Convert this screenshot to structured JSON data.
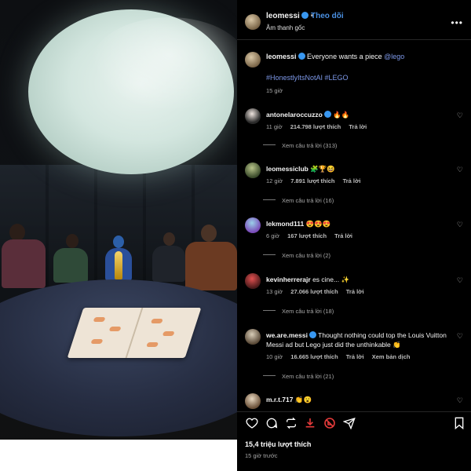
{
  "header": {
    "username": "leomessi",
    "separator": "•",
    "follow_label": "Theo dõi",
    "audio_label": "Âm thanh gốc",
    "more_icon": "more-horizontal-icon"
  },
  "caption": {
    "username": "leomessi",
    "text": "Everyone wants a piece",
    "mention": "@lego",
    "hashtags": "#HonestlyItsNotAI #LEGO",
    "time": "15 giờ"
  },
  "comments": [
    {
      "username": "antonelaroccuzzo",
      "body": "🔥🔥",
      "time": "11 giờ",
      "likes": "214.798 lượt thích",
      "reply": "Trả lời",
      "extra": "",
      "view_replies": "Xem câu trả lời (313)"
    },
    {
      "username": "leomessiclub",
      "body": "🧩🏆😆",
      "time": "12 giờ",
      "likes": "7.891 lượt thích",
      "reply": "Trả lời",
      "extra": "",
      "view_replies": "Xem câu trả lời (16)"
    },
    {
      "username": "lekmond111",
      "body": "😍😍😍",
      "time": "6 giờ",
      "likes": "167 lượt thích",
      "reply": "Trả lời",
      "extra": "",
      "view_replies": "Xem câu trả lời (2)"
    },
    {
      "username": "kevinherrerajr",
      "body": "es cine... ✨",
      "time": "13 giờ",
      "likes": "27.066 lượt thích",
      "reply": "Trả lời",
      "extra": "",
      "view_replies": "Xem câu trả lời (18)"
    },
    {
      "username": "we.are.messi",
      "body": "Thought nothing could top the Louis Vuitton Messi ad but Lego just did the unthinkable 👏",
      "time": "10 giờ",
      "likes": "16.665 lượt thích",
      "reply": "Trả lời",
      "extra": "Xem bản dịch",
      "view_replies": "Xem câu trả lời (21)"
    },
    {
      "username": "m.r.t.717",
      "body": "👏😮",
      "time": "",
      "likes": "",
      "reply": "",
      "extra": "",
      "view_replies": ""
    }
  ],
  "actions": {
    "like_icon": "heart-icon",
    "comment_icon": "comment-icon",
    "repost_icon": "repost-icon",
    "save_download_icon": "download-icon",
    "remix_icon": "remix-icon",
    "share_icon": "share-icon",
    "bookmark_icon": "bookmark-icon"
  },
  "footer": {
    "likes": "15,4 triệu lượt thích",
    "time": "15 giờ trước"
  },
  "colors": {
    "panel_bg": "#000000",
    "link_blue": "#4a90e2",
    "hashtag": "#7d98e8",
    "verified": "#3897f0",
    "accent_red": "#e53b3b"
  }
}
